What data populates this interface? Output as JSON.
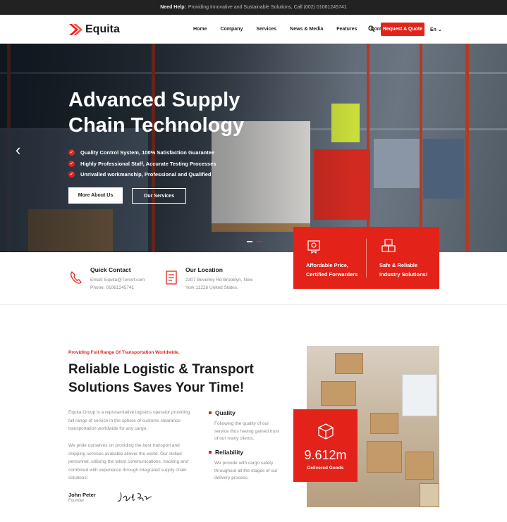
{
  "topbar": {
    "label": "Need Help:",
    "text": "Providing Innovative and Sustainable Solutions, Call (002) 01061245741"
  },
  "brand": {
    "name": "Equita",
    "accent": "#e3221a"
  },
  "nav": {
    "items": [
      "Home",
      "Company",
      "Services",
      "News & Media",
      "Features",
      "Contacts"
    ],
    "active": "Home",
    "quote_button": "Request A Quote",
    "language": "En"
  },
  "hero": {
    "title": "Advanced Supply Chain Technology",
    "points": [
      "Quality Control System, 100% Satisfaction Guarantee",
      "Highly Professional Staff, Accurate Testing Processes",
      "Unrivalled workmanship, Professional and Qualified"
    ],
    "primary_button": "More About Us",
    "secondary_button": "Our Services",
    "slide_count": 2,
    "active_slide": 2
  },
  "features": [
    {
      "icon": "certificate-icon",
      "title": "Affordable Price, Certified Forwarders"
    },
    {
      "icon": "boxes-icon",
      "title": "Safe & Reliable Industry Solutions!"
    }
  ],
  "contact": {
    "quick_title": "Quick Contact",
    "email": "Email: Equita@7oroof.com",
    "phone": "Phone: 01061245741",
    "location_title": "Our Location",
    "address": "2307 Beverley Rd Brooklyn, New York 11226 United States."
  },
  "about": {
    "tagline": "Providing Full Range Of Transportation Worldwide.",
    "title": "Reliable Logistic & Transport Solutions Saves Your Time!",
    "paragraph1": "Equita Group is a representative logistics operator providing full range of service in the sphere of customs clearance transportation worldwide for any cargo.",
    "paragraph2": "We pride ourselves on providing the best transport and shipping services available allover the world. Our skilled personnel, utilising the latest communications, tracking and combined with experience through integrated supply chain solutions!",
    "founder_name": "John Peter",
    "founder_role": "Founder",
    "signature": "John Peter",
    "quality_title": "Quality",
    "quality_text": "Following the quality of our service thus having gained trust of our many clients.",
    "reliability_title": "Reliability",
    "reliability_text": "We provide with cargo safety throughout all the stages of our delivery process.",
    "stat_value": "9.612m",
    "stat_label": "Delivered Goods"
  }
}
